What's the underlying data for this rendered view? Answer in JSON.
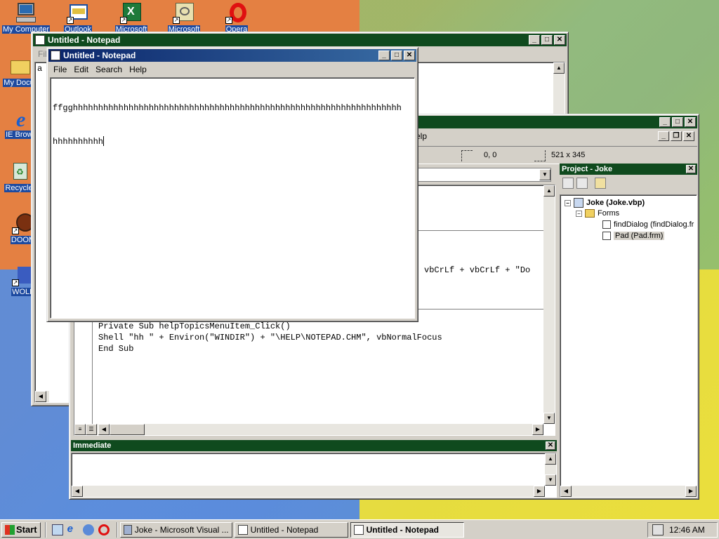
{
  "desktop": {
    "icons": [
      {
        "label": "My Computer",
        "icon": "my-computer-icon"
      },
      {
        "label": "Outlook",
        "icon": "outlook-icon"
      },
      {
        "label": "Microsoft",
        "icon": "excel-icon"
      },
      {
        "label": "Microsoft",
        "icon": "microsoft-app-icon"
      },
      {
        "label": "Opera",
        "icon": "opera-icon"
      },
      {
        "label": "My Docu",
        "icon": "my-documents-icon"
      },
      {
        "label": "IE Browser",
        "icon": "ie-icon"
      },
      {
        "label": "Recycle",
        "icon": "recycle-bin-icon"
      },
      {
        "label": "DOOM",
        "icon": "doom-icon"
      },
      {
        "label": "WOLF",
        "icon": "wolf-icon"
      }
    ]
  },
  "bg_notepad": {
    "title": "Untitled - Notepad",
    "menu_first": "Fil",
    "text": "a"
  },
  "notepad": {
    "title": "Untitled - Notepad",
    "menu": [
      "File",
      "Edit",
      "Search",
      "Help"
    ],
    "text_line1": "ffgghhhhhhhhhhhhhhhhhhhhhhhhhhhhhhhhhhhhhhhhhhhhhhhhhhhhhhhhhhhhhhhhh",
    "text_line2": "hhhhhhhhhh"
  },
  "vb": {
    "menu_tail": "elp",
    "position": "0, 0",
    "size": "521 x 345",
    "code_mid": "vbCrLf + vbCrLf + \"Do",
    "code_lines": [
      "Private Sub helpTopicsMenuItem_Click()",
      "Shell \"hh \" + Environ(\"WINDIR\") + \"\\HELP\\NOTEPAD.CHM\", vbNormalFocus",
      "End Sub"
    ],
    "project": {
      "title": "Project - Joke",
      "root": "Joke (Joke.vbp)",
      "folder": "Forms",
      "items": [
        "findDialog (findDialog.fr",
        "Pad (Pad.frm)"
      ]
    },
    "immediate_title": "Immediate"
  },
  "taskbar": {
    "start": "Start",
    "buttons": [
      "Joke - Microsoft Visual ...",
      "Untitled - Notepad",
      "Untitled - Notepad"
    ],
    "clock": "12:46 AM"
  },
  "colors": {
    "titlebar_green": "#0f4a1e",
    "titlebar_blue": "#0a246a",
    "desktop_orange": "#e4803f"
  }
}
